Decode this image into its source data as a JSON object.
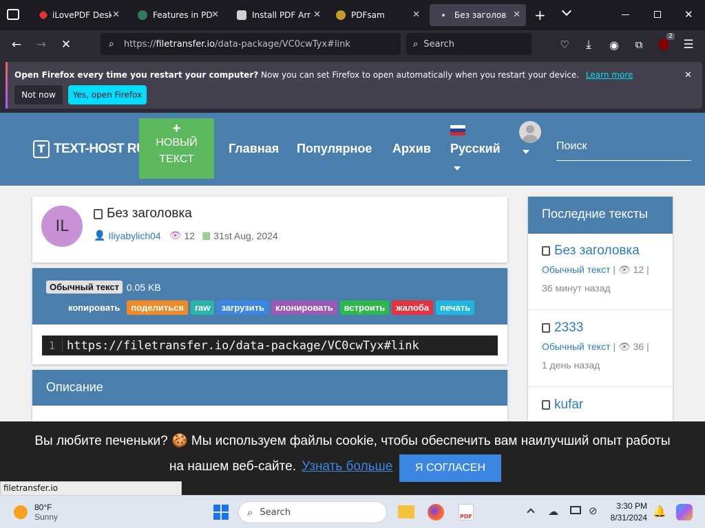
{
  "browser": {
    "tabs": [
      {
        "title": "iLovePDF Desktop",
        "color": "#e5322d"
      },
      {
        "title": "Features in PDFsam",
        "color": "#2e7d5b"
      },
      {
        "title": "Install PDF Arranger",
        "color": "#6a6a6a"
      },
      {
        "title": "PDFsam",
        "color": "#c89a2a"
      },
      {
        "title": "Без заголовка - Т",
        "color": "#888888"
      }
    ],
    "url_prefix": "https://",
    "url_domain": "filetransfer.io",
    "url_path": "/data-package/VC0cwTyx#link",
    "search_placeholder": "Search",
    "extension_badge": "2"
  },
  "notification": {
    "bold": "Open Firefox every time you restart your computer?",
    "text": "Now you can set Firefox to open automatically when you restart your device.",
    "learn_more": "Learn more",
    "not_now": "Not now",
    "yes": "Yes, open Firefox"
  },
  "site": {
    "logo": "TEXT-HOST RU",
    "new_text_plus": "+",
    "new_text_line1": "НОВЫЙ",
    "new_text_line2": "ТЕКСТ",
    "nav": [
      "Главная",
      "Популярное",
      "Архив",
      "Русский"
    ],
    "search_placeholder": "Поиск"
  },
  "post": {
    "avatar_initials": "IL",
    "title": "Без заголовка",
    "author": "Iliyabylich04",
    "views": "12",
    "date": "31st Aug, 2024",
    "type_badge": "Обычный текст",
    "size": "0.05 KB",
    "actions": [
      {
        "label": "копировать",
        "color": "#4a7fad"
      },
      {
        "label": "поделиться",
        "color": "#f08a24"
      },
      {
        "label": "raw",
        "color": "#2bb5a8"
      },
      {
        "label": "загрузить",
        "color": "#3a86e0"
      },
      {
        "label": "клонировать",
        "color": "#9b59b6"
      },
      {
        "label": "встроить",
        "color": "#2db84c"
      },
      {
        "label": "жалоба",
        "color": "#e5323c"
      },
      {
        "label": "печать",
        "color": "#1fb6e0"
      }
    ],
    "code_line_no": "1",
    "code": "https://filetransfer.io/data-package/VC0cwTyx#link",
    "description_title": "Описание"
  },
  "sidebar": {
    "title": "Последние тексты",
    "items": [
      {
        "title": "Без заголовка",
        "type": "Обычный текст",
        "views": "12",
        "time": "36 минут назад"
      },
      {
        "title": "2333",
        "type": "Обычный текст",
        "views": "36",
        "time": "1 день назад"
      },
      {
        "title": "kufar"
      }
    ]
  },
  "cookie": {
    "line1": "Вы любите печеньки? 🍪 Мы используем файлы cookie, чтобы обеспечить вам наилучший опыт работы",
    "line2": "на нашем веб-сайте.",
    "link": "Узнать больше",
    "button": "Я СОГЛАСЕН"
  },
  "status_url": "filetransfer.io",
  "taskbar": {
    "temp": "80°F",
    "weather": "Sunny",
    "search": "Search",
    "time": "3:30 PM",
    "date": "8/31/2024"
  }
}
